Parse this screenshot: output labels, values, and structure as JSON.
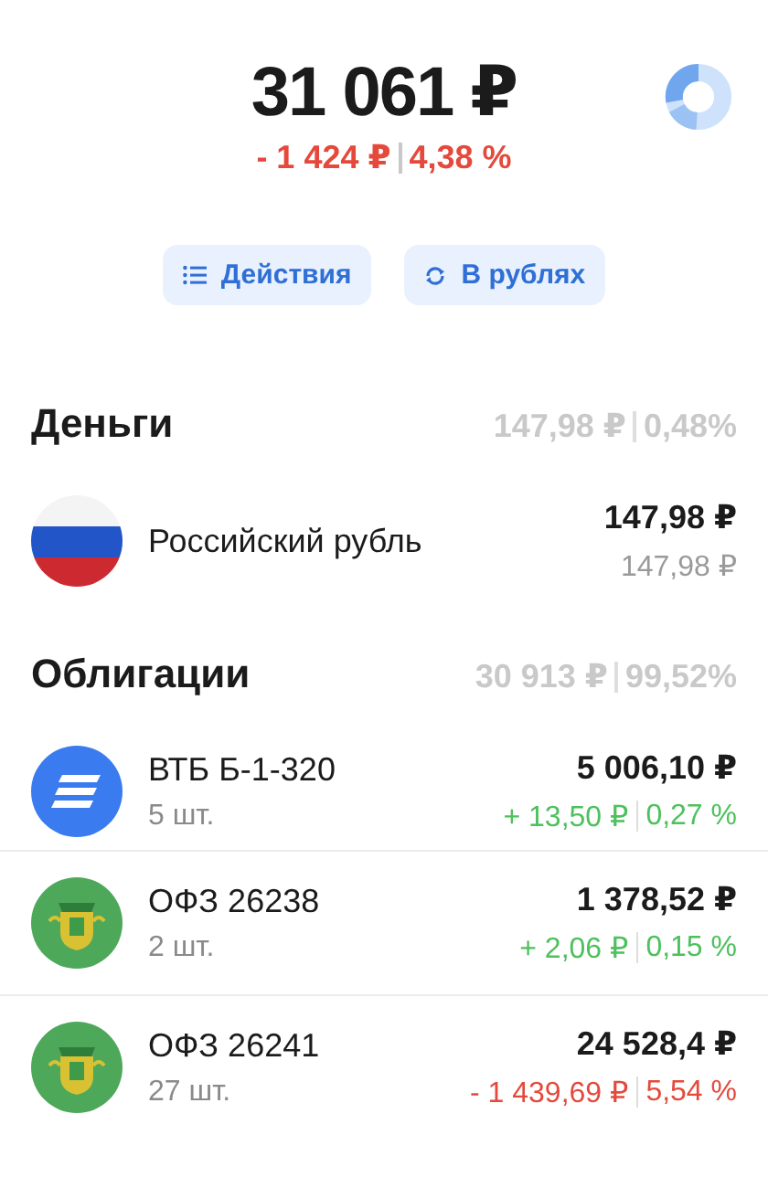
{
  "summary": {
    "total": "31 061 ₽",
    "change": "- 1 424 ₽",
    "change_percent": "4,38 %",
    "color": "#e5493c"
  },
  "actions": [
    {
      "label": "Действия"
    },
    {
      "label": "В рублях"
    }
  ],
  "sections": [
    {
      "title": "Деньги",
      "total": "147,98 ₽",
      "share": "0,48%",
      "items": [
        {
          "kind": "flag",
          "name": "Российский рубль",
          "value": "147,98 ₽",
          "subvalue": "147,98 ₽"
        }
      ]
    },
    {
      "title": "Облигации",
      "total": "30 913 ₽",
      "share": "99,52%",
      "items": [
        {
          "kind": "stripes",
          "name": "ВТБ Б-1-320",
          "quantity": "5 шт.",
          "value": "5 006,10 ₽",
          "change": "+ 13,50 ₽",
          "change_percent": "0,27 %",
          "color": "#4cc15d"
        },
        {
          "kind": "emblem",
          "name": "ОФЗ 26238",
          "quantity": "2 шт.",
          "value": "1 378,52 ₽",
          "change": "+ 2,06 ₽",
          "change_percent": "0,15 %",
          "color": "#4cc15d"
        },
        {
          "kind": "emblem",
          "name": "ОФЗ 26241",
          "quantity": "27 шт.",
          "value": "24 528,4 ₽",
          "change": "- 1 439,69 ₽",
          "change_percent": "5,54 %",
          "color": "#e5493c"
        }
      ]
    }
  ]
}
